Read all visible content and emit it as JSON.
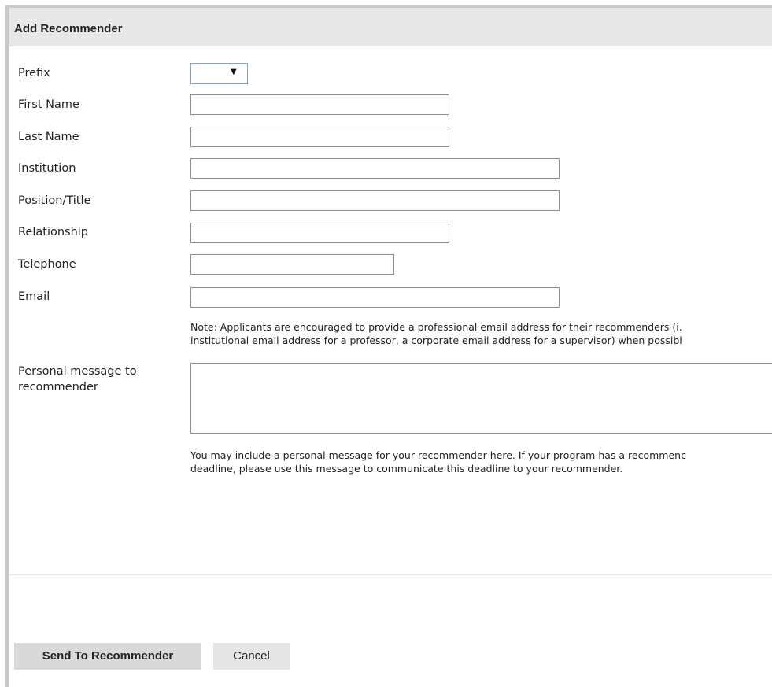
{
  "dialog": {
    "title": "Add Recommender"
  },
  "form": {
    "prefix": {
      "label": "Prefix",
      "value": "",
      "icon": "chevron-down-icon"
    },
    "first_name": {
      "label": "First Name",
      "value": ""
    },
    "last_name": {
      "label": "Last Name",
      "value": ""
    },
    "institution": {
      "label": "Institution",
      "value": ""
    },
    "position_title": {
      "label": "Position/Title",
      "value": ""
    },
    "relationship": {
      "label": "Relationship",
      "value": ""
    },
    "telephone": {
      "label": "Telephone",
      "value": ""
    },
    "email": {
      "label": "Email",
      "value": "",
      "note_line1": "Note: Applicants are encouraged to provide a professional email address for their recommenders (i.",
      "note_line2": "institutional email address for a professor, a corporate email address for a supervisor) when possibl"
    },
    "personal_message": {
      "label_line1": "Personal message to",
      "label_line2": "recommender",
      "value": "",
      "help_line1": "You may include a personal message for your recommender here. If your program has a recommenc",
      "help_line2": "deadline, please use this message to communicate this deadline to your recommender."
    }
  },
  "actions": {
    "send_label": "Send To Recommender",
    "cancel_label": "Cancel"
  },
  "colors": {
    "header_bg": "#e8e8e8",
    "select_border": "#7aa7d8"
  }
}
